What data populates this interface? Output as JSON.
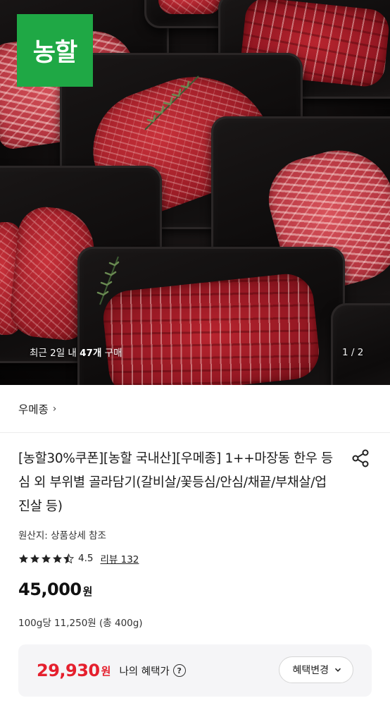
{
  "hero": {
    "brand_logo_text": "농할",
    "recent_purchase_prefix": "최근 2일 내 ",
    "recent_purchase_count": "47개",
    "recent_purchase_suffix": " 구매",
    "pager": "1 / 2"
  },
  "brand": {
    "label": "우메종",
    "chevron": "›"
  },
  "product": {
    "title": "[농할30%쿠폰][농할 국내산][우메종] 1++마장동 한우 등심 외 부위별 골라담기(갈비살/꽃등심/안심/채끝/부채살/업진살 등)",
    "origin": "원산지: 상품상세 참조",
    "rating": "4.5",
    "rating_stars": 4.5,
    "review_link": "리뷰 132",
    "price": "45,000",
    "price_unit": "원",
    "unit_price": "100g당 11,250원 (총 400g)"
  },
  "benefit": {
    "price": "29,930",
    "price_unit": "원",
    "label": "나의 혜택가",
    "help_glyph": "?",
    "change_button": "혜택변경"
  },
  "colors": {
    "brand_green": "#1fa845",
    "benefit_red": "#e5202e",
    "benefit_bg": "#f5f5f7"
  },
  "icons": [
    "share-icon",
    "star-icon",
    "question-icon",
    "chevron-down-icon",
    "chevron-right-icon"
  ]
}
